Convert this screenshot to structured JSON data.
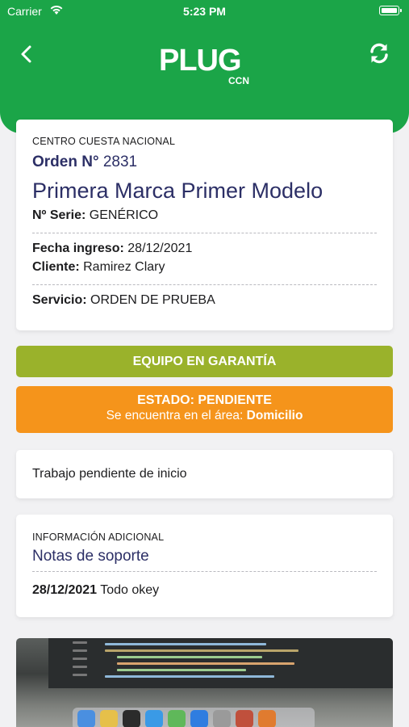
{
  "status_bar": {
    "carrier": "Carrier",
    "time": "5:23 PM"
  },
  "header": {
    "logo_text": "PLUG",
    "logo_sub": "CCN"
  },
  "order_card": {
    "center": "CENTRO CUESTA NACIONAL",
    "order_label": "Orden N°",
    "order_number": "2831",
    "model": "Primera Marca Primer Modelo",
    "serie_label": "Nº Serie:",
    "serie_value": "GENÉRICO",
    "fecha_label": "Fecha ingreso:",
    "fecha_value": "28/12/2021",
    "cliente_label": "Cliente:",
    "cliente_value": "Ramirez Clary",
    "servicio_label": "Servicio:",
    "servicio_value": "ORDEN DE PRUEBA"
  },
  "warranty_banner": {
    "label": "EQUIPO EN GARANTÍA",
    "color": "#9ab22b"
  },
  "status_banner": {
    "title": "ESTADO: PENDIENTE",
    "area_prefix": "Se encuentra en el área:",
    "area_value": "Domicilio",
    "color": "#f5941b"
  },
  "work_card": {
    "text": "Trabajo pendiente de inicio"
  },
  "info_card": {
    "label": "INFORMACIÓN ADICIONAL",
    "title": "Notas de soporte",
    "note_date": "28/12/2021",
    "note_text": "Todo okey"
  },
  "colors": {
    "header_green": "#1ba548",
    "title_navy": "#2c2f66"
  }
}
